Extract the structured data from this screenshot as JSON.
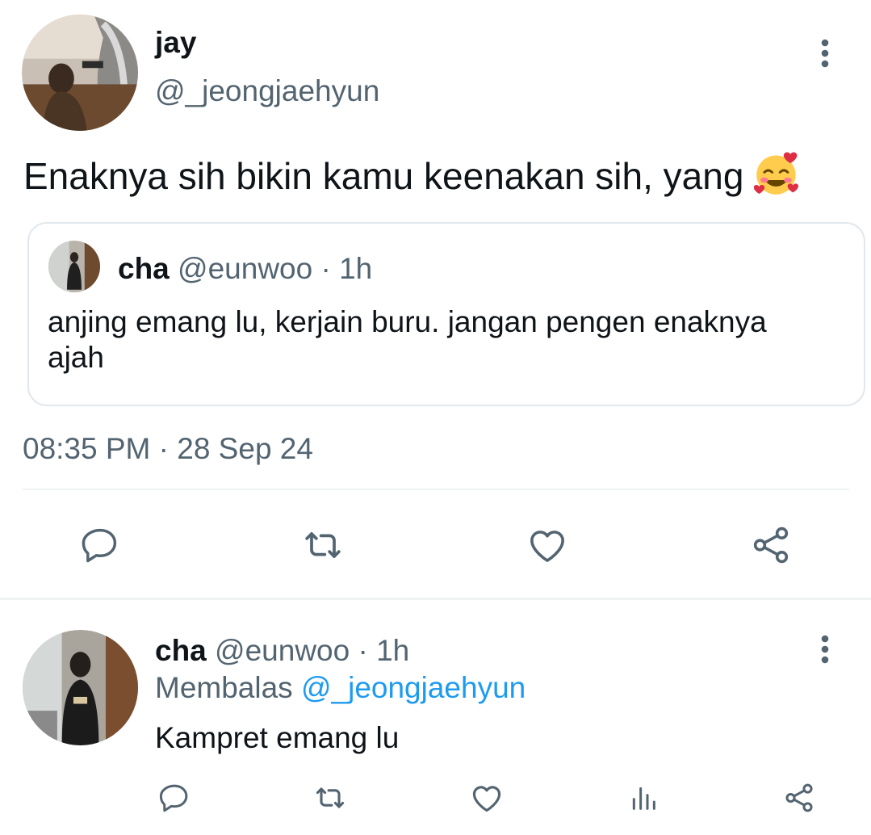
{
  "main_tweet": {
    "display_name": "jay",
    "handle": "@_jeongjaehyun",
    "text": "Enaknya sih bikin kamu keenakan sih, yang",
    "emoji": "🥰",
    "emoji_name": "smiling-face-with-hearts-icon",
    "timestamp": "08:35 PM · 28 Sep 24",
    "quoted": {
      "display_name": "cha",
      "handle": "@eunwoo",
      "time": "· 1h",
      "text": "anjing emang lu, kerjain buru. jangan pengen enaknya ajah"
    },
    "actions": [
      "reply-icon",
      "retweet-icon",
      "like-icon",
      "share-icon"
    ]
  },
  "reply": {
    "display_name": "cha",
    "handle": "@eunwoo",
    "time": "· 1h",
    "replying_prefix": "Membalas",
    "replying_to": "@_jeongjaehyun",
    "text": "Kampret emang lu",
    "actions": [
      "reply-icon",
      "retweet-icon",
      "like-icon",
      "views-icon",
      "share-icon"
    ]
  },
  "colors": {
    "text": "#0f1419",
    "muted": "#536471",
    "link": "#1d9bf0",
    "icon": "#536471",
    "divider": "#eff3f4"
  }
}
